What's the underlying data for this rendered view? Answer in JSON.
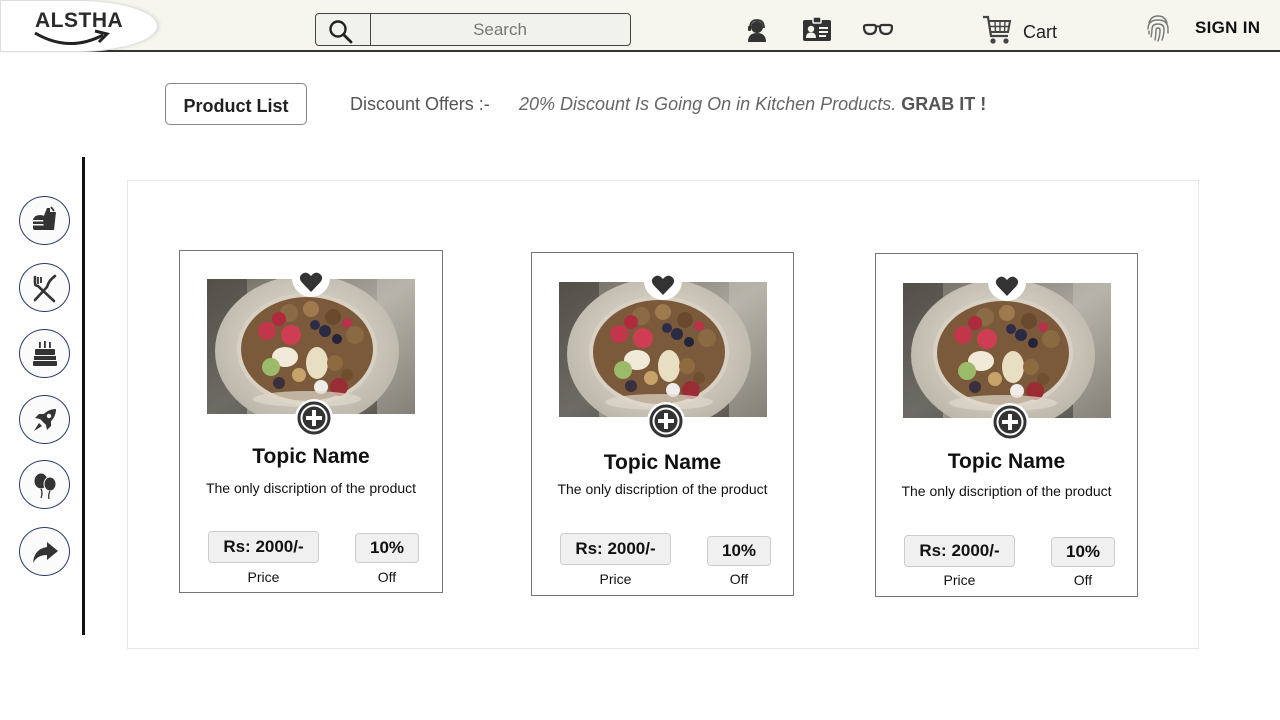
{
  "header": {
    "logo_text": "ALSTHA",
    "search_placeholder": "Search",
    "cart_label": "Cart",
    "signin_label": "SIGN IN",
    "icons": [
      "support-agent-icon",
      "contact-card-icon",
      "glasses-icon",
      "cart-icon",
      "fingerprint-icon"
    ]
  },
  "subbar": {
    "product_list_label": "Product List",
    "offer_label": "Discount Offers :-",
    "offer_text": "20% Discount Is Going On in Kitchen Products.",
    "offer_cta": "GRAB IT !"
  },
  "sidebar": {
    "items": [
      {
        "icon": "fast-food-icon"
      },
      {
        "icon": "fork-knife-icon"
      },
      {
        "icon": "birthday-cake-icon"
      },
      {
        "icon": "rocket-icon"
      },
      {
        "icon": "balloons-icon"
      },
      {
        "icon": "share-arrow-icon"
      }
    ]
  },
  "products": [
    {
      "title": "Topic Name",
      "description": "The only discription of the product",
      "price": "Rs: 2000/-",
      "price_label": "Price",
      "discount": "10%",
      "discount_label": "Off"
    },
    {
      "title": "Topic Name",
      "description": "The only discription of the product",
      "price": "Rs: 2000/-",
      "price_label": "Price",
      "discount": "10%",
      "discount_label": "Off"
    },
    {
      "title": "Topic Name",
      "description": "The only discription of the product",
      "price": "Rs: 2000/-",
      "price_label": "Price",
      "discount": "10%",
      "discount_label": "Off"
    }
  ],
  "colors": {
    "header_bg": "#f6f6ef",
    "sidebar_ring": "#2a3a6a",
    "icon_dark": "#333333"
  }
}
